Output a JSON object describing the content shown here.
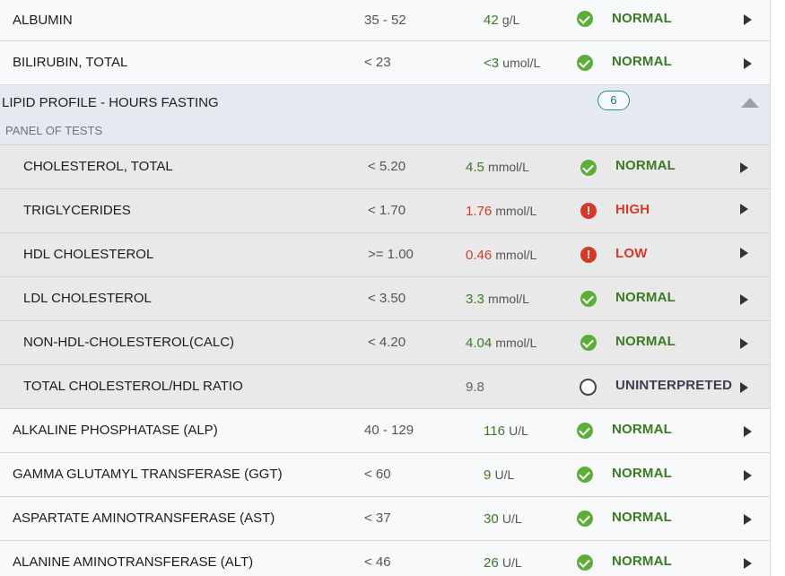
{
  "rows_top": [
    {
      "name": "ALBUMIN",
      "range": "35 - 52",
      "value": "42",
      "unit": "g/L",
      "status": "NORMAL"
    },
    {
      "name": "BILIRUBIN, TOTAL",
      "range": "< 23",
      "value": "<3",
      "unit": "umol/L",
      "status": "NORMAL"
    }
  ],
  "group": {
    "title": "LIPID PROFILE - HOURS FASTING",
    "subtitle": "PANEL OF TESTS",
    "count": "6"
  },
  "rows_sub": [
    {
      "name": "CHOLESTEROL, TOTAL",
      "range": "< 5.20",
      "value": "4.5",
      "unit": "mmol/L",
      "status": "NORMAL"
    },
    {
      "name": "TRIGLYCERIDES",
      "range": "< 1.70",
      "value": "1.76",
      "unit": "mmol/L",
      "status": "HIGH"
    },
    {
      "name": "HDL CHOLESTEROL",
      "range": ">= 1.00",
      "value": "0.46",
      "unit": "mmol/L",
      "status": "LOW"
    },
    {
      "name": "LDL CHOLESTEROL",
      "range": "< 3.50",
      "value": "3.3",
      "unit": "mmol/L",
      "status": "NORMAL"
    },
    {
      "name": "NON-HDL-CHOLESTEROL(CALC)",
      "range": "< 4.20",
      "value": "4.04",
      "unit": "mmol/L",
      "status": "NORMAL"
    },
    {
      "name": "TOTAL CHOLESTEROL/HDL RATIO",
      "range": "",
      "value": "9.8",
      "unit": "",
      "status": "UNINTERPRETED"
    }
  ],
  "rows_bottom": [
    {
      "name": "ALKALINE PHOSPHATASE (ALP)",
      "range": "40 - 129",
      "value": "116",
      "unit": "U/L",
      "status": "NORMAL"
    },
    {
      "name": "GAMMA GLUTAMYL TRANSFERASE (GGT)",
      "range": "< 60",
      "value": "9",
      "unit": "U/L",
      "status": "NORMAL"
    },
    {
      "name": "ASPARTATE AMINOTRANSFERASE (AST)",
      "range": "< 37",
      "value": "30",
      "unit": "U/L",
      "status": "NORMAL"
    },
    {
      "name": "ALANINE AMINOTRANSFERASE (ALT)",
      "range": "< 46",
      "value": "26",
      "unit": "U/L",
      "status": "NORMAL"
    }
  ],
  "colors": {
    "normal": "#3c7a22",
    "abnormal": "#d23b2a",
    "uninterpreted": "#3a3f4a",
    "badge": "#2a8a9a"
  },
  "icons": {
    "normal": "check-circle-icon",
    "abnormal": "alert-circle-icon",
    "uninterpreted": "empty-circle-icon",
    "row_action": "chevron-right-icon",
    "collapse": "caret-up-icon"
  }
}
